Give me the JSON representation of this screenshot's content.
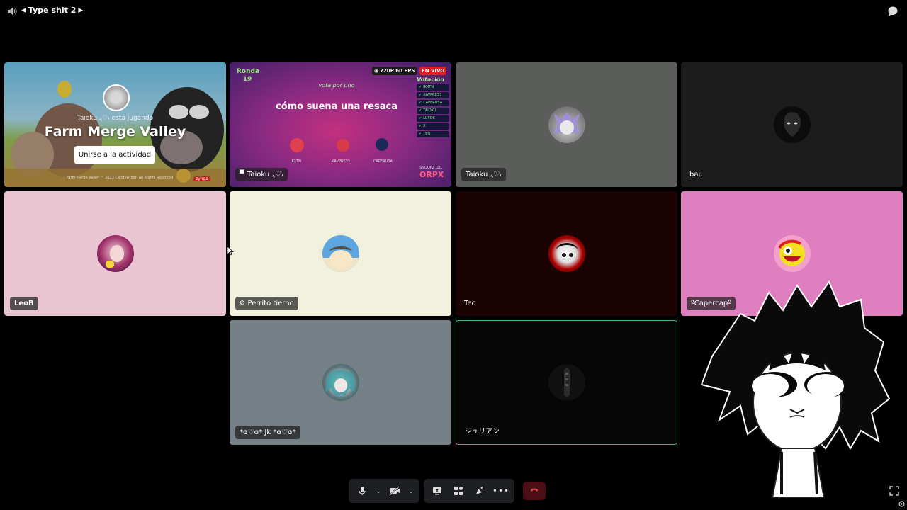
{
  "header": {
    "channel_name": "Type shit 2",
    "icons": {
      "volume": "speaker-icon",
      "prev": "triangle-left-icon",
      "next": "triangle-right-icon",
      "chat": "chat-bubble-icon"
    }
  },
  "tiles": {
    "activity": {
      "status": "Taioku ៹♡៸ está jugando",
      "game_title": "Farm Merge Valley",
      "join_button": "Unirse a la actividad",
      "footer": "Farm Merge Valley ™ 2023 Candywriter. All Rights Reserved",
      "badge": "zynga"
    },
    "stream": {
      "quality": "720P 60 FPS",
      "live": "EN VIVO",
      "logo": "Ronda 19",
      "subtitle": "vota por uno",
      "question": "cómo suena una resaca",
      "votes_title": "Votación",
      "brand": "ORPX",
      "brand_small": "SNOOPZ.LOL",
      "player_names": [
        "IKXTN",
        "XAVPRE33",
        "CAPERUSA"
      ],
      "vote_rows": [
        "IKXTN",
        "XAVPRE33",
        "CAPERUSA",
        "TAIOKU",
        "LUTOK",
        "X",
        "TEO"
      ],
      "user": "Taioku ៹♡៸"
    },
    "taioku_cam": {
      "user": "Taioku ៹♡៸"
    },
    "bau": {
      "user": "bau"
    },
    "leob": {
      "user": "LeoB"
    },
    "perrito": {
      "user": "Perrito tierno"
    },
    "teo": {
      "user": "Teo"
    },
    "capercap": {
      "user": "ºCapercapº"
    },
    "jk": {
      "user": "*ɞ♡ɞ* Jk *ɞ♡ɞ*"
    },
    "julian": {
      "user": "ジュリアン"
    }
  },
  "toolbar": {
    "icons": [
      "microphone-icon",
      "chevron-down-icon",
      "camera-off-icon",
      "chevron-down-icon",
      "screen-share-icon",
      "activities-icon",
      "soundboard-icon",
      "more-icon",
      "disconnect-icon"
    ]
  },
  "colors": {
    "leob_bg": "#e9c4d1",
    "perrito_bg": "#f1f1de",
    "teo_bg": "#1c0303",
    "capercap_bg": "#e07fbf",
    "jk_bg": "#747f86",
    "taioku_bg": "#5b5d5a",
    "speaking_border": "#43b581",
    "leave_red": "#4b0e14"
  }
}
